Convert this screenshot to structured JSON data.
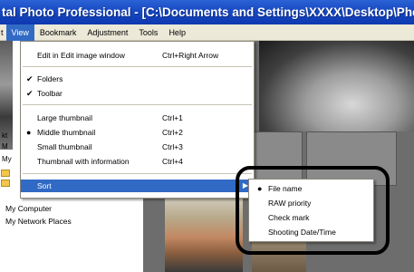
{
  "window": {
    "title": "tal Photo Professional - [C:\\Documents and Settings\\XXXX\\Desktop\\Phot"
  },
  "menubar": {
    "items": [
      {
        "label": "t",
        "active": false
      },
      {
        "label": "View",
        "active": true
      },
      {
        "label": "Bookmark",
        "active": false
      },
      {
        "label": "Adjustment",
        "active": false
      },
      {
        "label": "Tools",
        "active": false
      },
      {
        "label": "Help",
        "active": false
      }
    ]
  },
  "view_menu": {
    "edit_window": {
      "label": "Edit in Edit image window",
      "shortcut": "Ctrl+Right Arrow"
    },
    "folders": {
      "label": "Folders",
      "checked": true
    },
    "toolbar": {
      "label": "Toolbar",
      "checked": true
    },
    "large_thumbnail": {
      "label": "Large thumbnail",
      "shortcut": "Ctrl+1"
    },
    "middle_thumbnail": {
      "label": "Middle thumbnail",
      "shortcut": "Ctrl+2",
      "selected": true
    },
    "small_thumbnail": {
      "label": "Small thumbnail",
      "shortcut": "Ctrl+3"
    },
    "thumbnail_info": {
      "label": "Thumbnail with information",
      "shortcut": "Ctrl+4"
    },
    "sort": {
      "label": "Sort",
      "highlighted": true
    }
  },
  "sort_submenu": {
    "file_name": {
      "label": "File name",
      "selected": true
    },
    "raw_priority": {
      "label": "RAW priority"
    },
    "check_mark": {
      "label": "Check mark"
    },
    "shooting_date": {
      "label": "Shooting Date/Time"
    }
  },
  "left_panel": {
    "frag_1": "kt",
    "frag_2": "M",
    "frag_3": "My",
    "my_computer": "My Computer",
    "my_network": "My Network Places"
  },
  "glyphs": {
    "check": "✔",
    "bullet": "●",
    "arrow": "▶"
  },
  "colors": {
    "title_bar": "#1848c2",
    "menu_highlight": "#316ac5",
    "menu_bg": "#ece9d8"
  }
}
